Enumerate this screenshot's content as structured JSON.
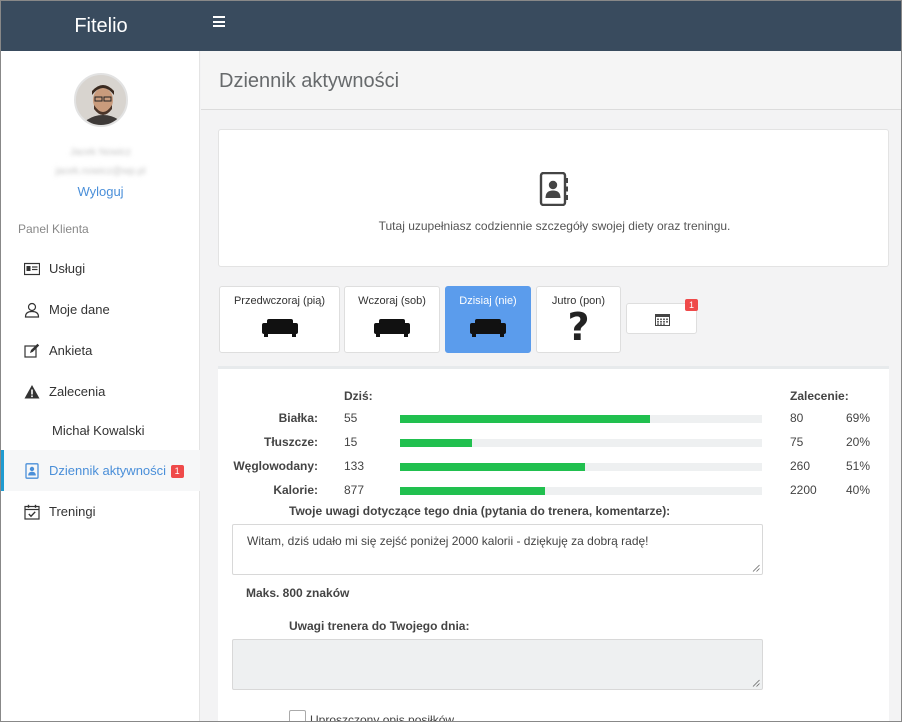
{
  "app": {
    "brand": "Fitelio"
  },
  "sidebar": {
    "user_name": "Jacek Nowicz",
    "user_email": "jacek.nowicz@wp.pl",
    "logout": "Wyloguj",
    "panel_label": "Panel Klienta",
    "items": [
      {
        "label": "Usługi",
        "icon": "id-card-icon"
      },
      {
        "label": "Moje dane",
        "icon": "user-icon"
      },
      {
        "label": "Ankieta",
        "icon": "edit-icon"
      },
      {
        "label": "Zalecenia",
        "icon": "warning-icon"
      },
      {
        "label": "Michał Kowalski",
        "icon": ""
      },
      {
        "label": "Dziennik aktywności",
        "icon": "contact-book-icon",
        "badge": "1",
        "active": true
      },
      {
        "label": "Treningi",
        "icon": "calendar-check-icon"
      }
    ]
  },
  "page": {
    "title": "Dziennik aktywności",
    "info_text": "Tutaj uzupełniasz codziennie szczegóły swojej diety oraz treningu."
  },
  "days": [
    {
      "label": "Przedwczoraj (pią)",
      "icon": "sofa-icon"
    },
    {
      "label": "Wczoraj (sob)",
      "icon": "sofa-icon"
    },
    {
      "label": "Dzisiaj (nie)",
      "icon": "sofa-icon",
      "active": true
    },
    {
      "label": "Jutro (pon)",
      "icon": "question-icon",
      "symbol": "?"
    }
  ],
  "calendar_badge": "1",
  "nutrition": {
    "today_header": "Dziś:",
    "recommend_header": "Zalecenie:",
    "rows": [
      {
        "name": "Białka:",
        "value": "55",
        "recommended": "80",
        "percent": "69%",
        "progress": 0.69
      },
      {
        "name": "Tłuszcze:",
        "value": "15",
        "recommended": "75",
        "percent": "20%",
        "progress": 0.2
      },
      {
        "name": "Węglowodany:",
        "value": "133",
        "recommended": "260",
        "percent": "51%",
        "progress": 0.51
      },
      {
        "name": "Kalorie:",
        "value": "877",
        "recommended": "2200",
        "percent": "40%",
        "progress": 0.4
      }
    ]
  },
  "notes": {
    "label": "Twoje uwagi dotyczące tego dnia (pytania do trenera, komentarze):",
    "value": "Witam, dziś udało mi się zejść poniżej 2000 kalorii - dziękuję za dobrą radę!",
    "max_label": "Maks. 800 znaków"
  },
  "trainer": {
    "label": "Uwagi trenera do Twojego dnia:",
    "value": ""
  },
  "simplified": {
    "label": "Uproszczony opis posiłków",
    "checked": false
  },
  "colors": {
    "topbar": "#394b5e",
    "accent": "#5b9cec",
    "progress": "#21c04f",
    "badge": "#ef4a4a",
    "link": "#4a8fd9"
  }
}
